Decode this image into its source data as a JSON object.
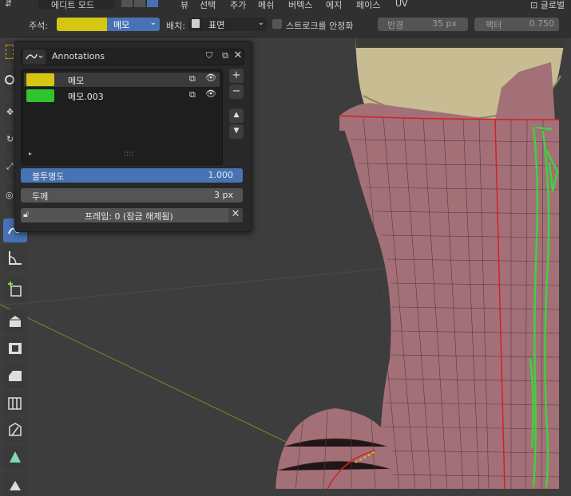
{
  "menubar": {
    "mode_label": "에디트 모드",
    "items": [
      "뷰",
      "선택",
      "추가",
      "메쉬",
      "버텍스",
      "에지",
      "페이스",
      "UV"
    ],
    "global_label": "글로벌"
  },
  "toolheader": {
    "annotation_label": "주석:",
    "annotation_name": "메모",
    "placement_label": "배치:",
    "placement_value": "표면",
    "stabilize_label": "스트로크를 안정화",
    "radius_label": "반경",
    "radius_value": "35 px",
    "factor_label": "팩터",
    "factor_value": "0.750"
  },
  "panel": {
    "datablock_name": "Annotations",
    "layers": [
      {
        "name": "메모",
        "color": "#d4c613",
        "selected": true
      },
      {
        "name": "메모.003",
        "color": "#2ec52e",
        "selected": false
      }
    ],
    "list_grip": "::::",
    "opacity_label": "불투명도",
    "opacity_value": "1.000",
    "opacity_fraction": 1.0,
    "thickness_label": "두께",
    "thickness_value": "3 px",
    "frame_text": "프레임: 0 (잠금 해제됨)"
  },
  "colors": {
    "accent": "#4772b3",
    "layer1": "#d4c613",
    "layer2": "#2ec52e",
    "mesh": "#a37078",
    "seam": "#d62020"
  }
}
